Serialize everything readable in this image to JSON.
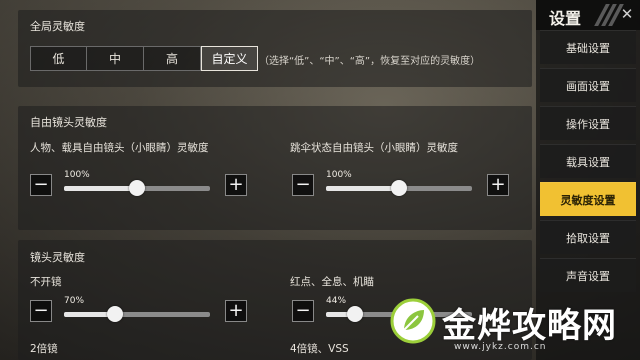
{
  "global_sensitivity": {
    "title": "全局灵敏度",
    "presets": [
      "低",
      "中",
      "高",
      "自定义"
    ],
    "active_preset": "自定义",
    "hint": "（选择“低”、“中”、“高”，恢复至对应的灵敏度）"
  },
  "free_camera": {
    "title": "自由镜头灵敏度",
    "sliders": [
      {
        "label": "人物、载具自由镜头（小眼睛）灵敏度",
        "value_text": "100%",
        "level": 0.5
      },
      {
        "label": "跳伞状态自由镜头（小眼睛）灵敏度",
        "value_text": "100%",
        "level": 0.5
      }
    ]
  },
  "scope": {
    "title": "镜头灵敏度",
    "sliders": [
      {
        "label": "不开镜",
        "value_text": "70%",
        "level": 0.35
      },
      {
        "label": "红点、全息、机瞄",
        "value_text": "44%",
        "level": 0.2
      }
    ],
    "more_labels": [
      "2倍镜",
      "4倍镜、VSS"
    ]
  },
  "nav": {
    "title": "设置",
    "items": [
      "基础设置",
      "画面设置",
      "操作设置",
      "载具设置",
      "灵敏度设置",
      "拾取设置",
      "声音设置"
    ],
    "active": "灵敏度设置"
  },
  "watermark": {
    "brand": "金烨攻略网",
    "url": "www.jykz.com.cn"
  },
  "colors": {
    "accent": "#f1c132",
    "slider_fill": "#e6e6e6",
    "slider_track": "#8b8b8b"
  },
  "icons": {
    "minus": "minus-icon",
    "plus": "plus-icon",
    "close": "close-icon"
  }
}
